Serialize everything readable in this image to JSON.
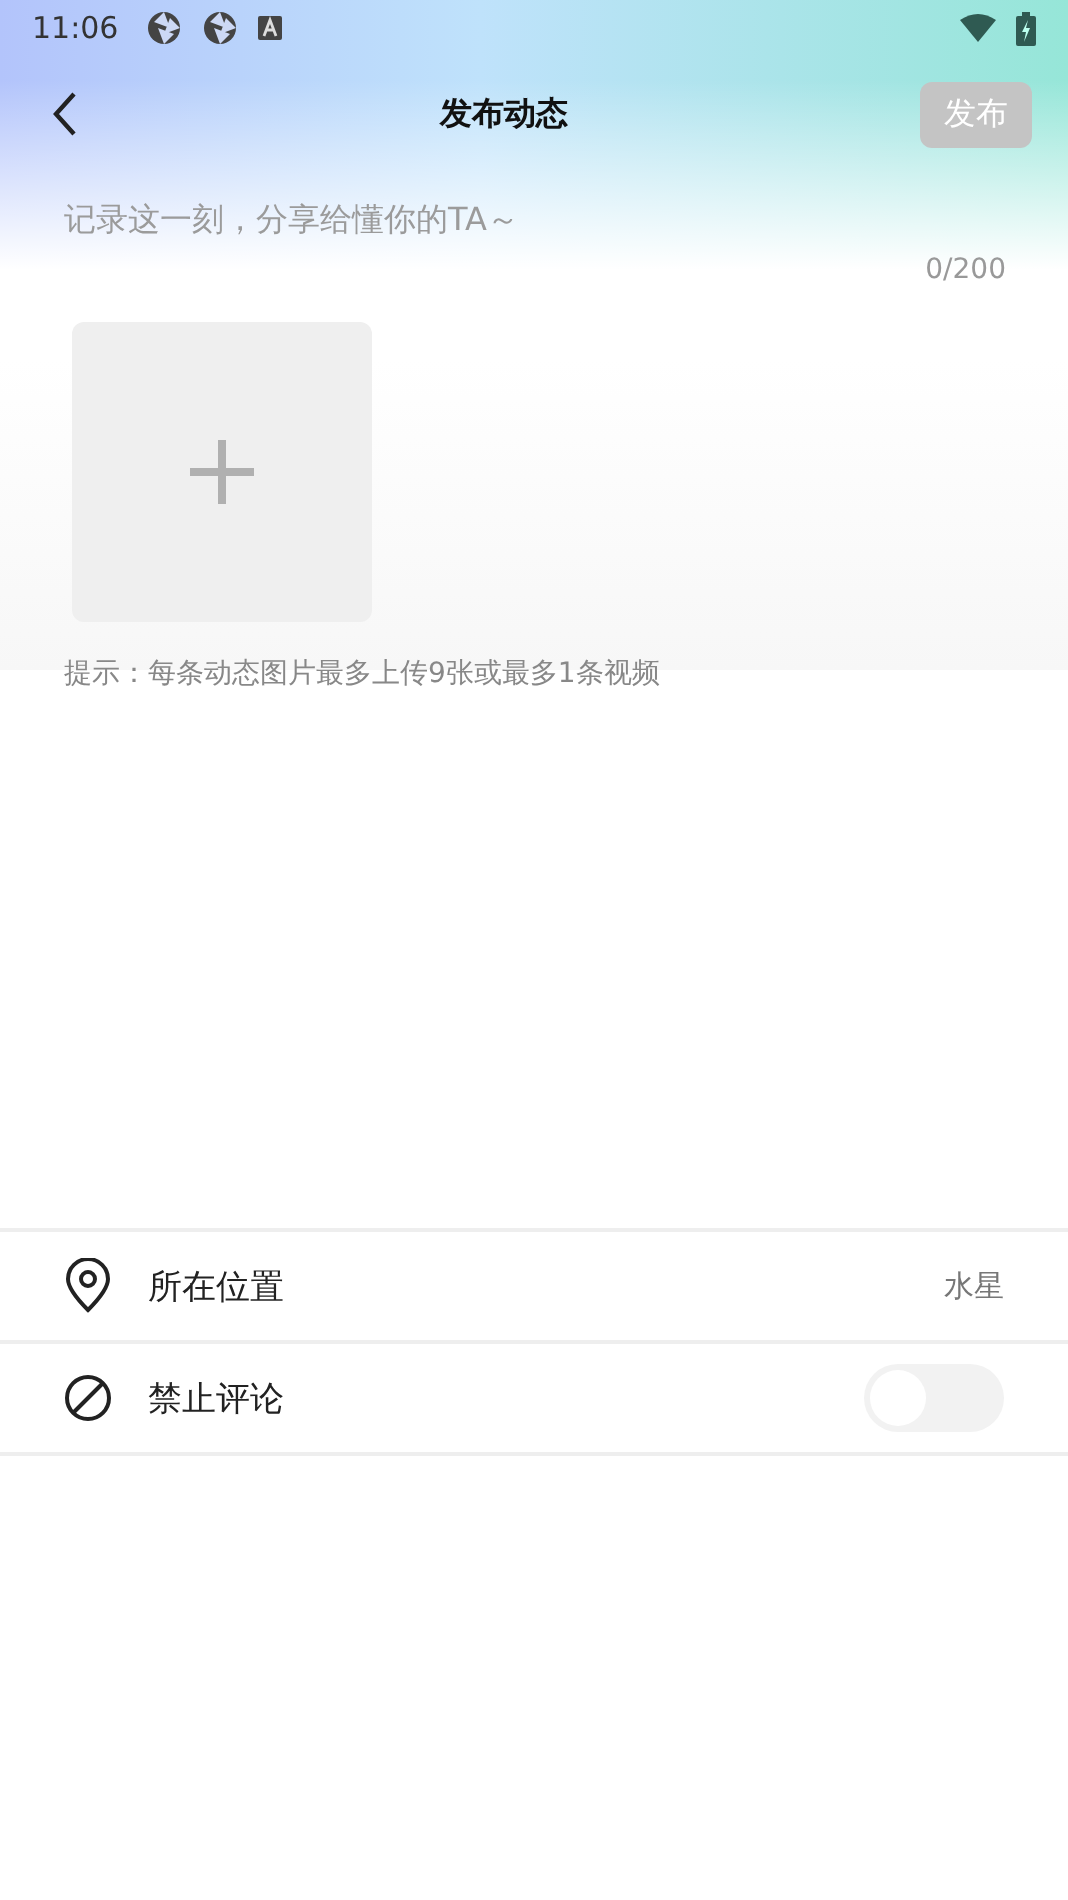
{
  "status_bar": {
    "time": "11:06"
  },
  "header": {
    "title": "发布动态",
    "publish_button": "发布"
  },
  "post": {
    "placeholder": "记录这一刻，分享给懂你的TA～",
    "counter": "0/200"
  },
  "hint": "提示：每条动态图片最多上传9张或最多1条视频",
  "options": [
    {
      "kind": "location",
      "label": "所在位置",
      "value": "水星"
    },
    {
      "kind": "toggle",
      "label": "禁止评论",
      "on": false
    }
  ]
}
